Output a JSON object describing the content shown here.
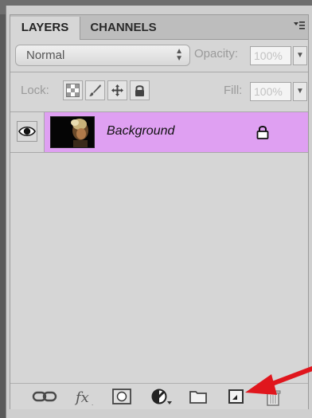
{
  "tabs": [
    {
      "label": "LAYERS",
      "active": true
    },
    {
      "label": "CHANNELS",
      "active": false
    }
  ],
  "panel_menu_icon": "panel-menu-icon",
  "blend_mode": {
    "value": "Normal"
  },
  "opacity": {
    "label": "Opacity:",
    "value": "100%"
  },
  "lock": {
    "label": "Lock:",
    "buttons": [
      "lock-transparent-pixels-icon",
      "lock-image-pixels-icon",
      "lock-position-icon",
      "lock-all-icon"
    ]
  },
  "fill": {
    "label": "Fill:",
    "value": "100%"
  },
  "layers": [
    {
      "name": "Background",
      "visible": true,
      "locked": true,
      "selected": true
    }
  ],
  "bottom_icons": [
    "link-layers-icon",
    "layer-style-fx-icon",
    "layer-mask-icon",
    "adjustment-layer-icon",
    "group-folder-icon",
    "new-layer-icon",
    "trash-icon"
  ],
  "colors": {
    "selected_row": "#dfa0f2",
    "arrow": "#e0161d"
  }
}
